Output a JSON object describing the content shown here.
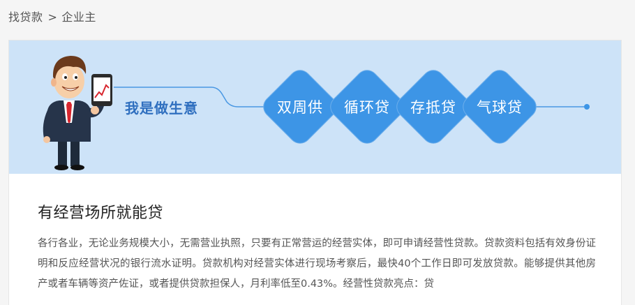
{
  "breadcrumb": {
    "root": "找贷款",
    "separator": ">",
    "current": "企业主"
  },
  "banner": {
    "slogan": "我是做生意",
    "products": [
      "双周供",
      "循环贷",
      "存抵贷",
      "气球贷"
    ],
    "colors": {
      "background": "#cde3f8",
      "diamond": "#3d95e6",
      "line": "#4a98e3",
      "slogan": "#2f6fbf"
    }
  },
  "section": {
    "title": "有经营场所就能贷",
    "description": "各行各业，无论业务规模大小，无需营业执照，只要有正常营运的经营实体，即可申请经营性贷款。贷款资料包括有效身份证明和反应经营状况的银行流水证明。贷款机构对经营实体进行现场考察后，最快40个工作日即可发放贷款。能够提供其他房产或者车辆等资产佐证，或者提供贷款担保人，月利率低至0.43%。经营性贷款亮点：贷"
  }
}
